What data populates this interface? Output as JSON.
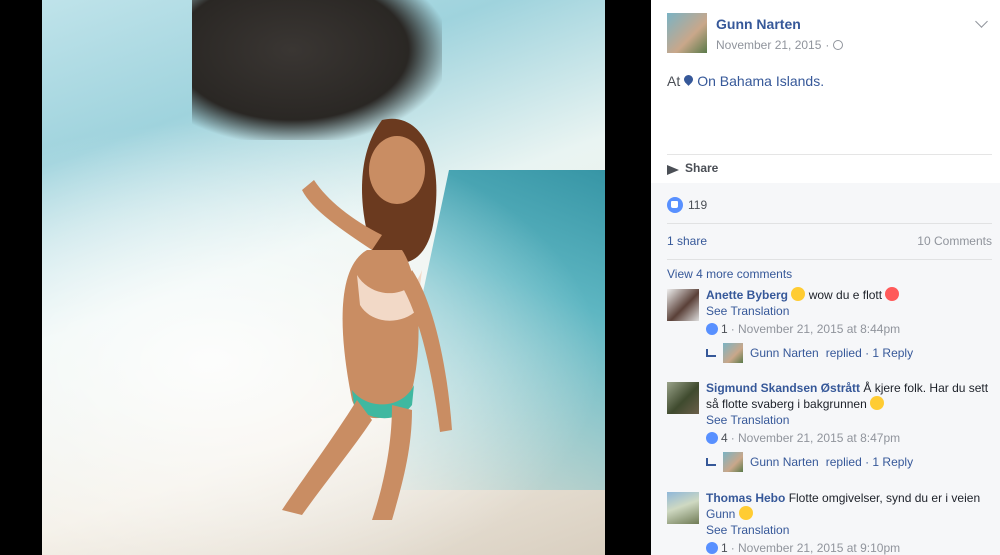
{
  "post": {
    "author": "Gunn Narten",
    "date": "November 21, 2015",
    "location_prefix": "At",
    "location": "On Bahama Islands.",
    "share_label": "Share",
    "likes_count": "119",
    "shares_text": "1 share",
    "comments_text": "10 Comments",
    "view_more": "View 4 more comments"
  },
  "comments": [
    {
      "name": "Anette Byberg",
      "text": "wow du e flott",
      "translate": "See Translation",
      "likes": "1",
      "timestamp": "· November 21, 2015 at 8:44pm",
      "reply_author": "Gunn Narten",
      "reply_text": "replied · 1 Reply"
    },
    {
      "name": "Sigmund Skandsen Østrått",
      "text": "Å kjere folk. Har du sett så flotte svaberg i bakgrunnen",
      "translate": "See Translation",
      "likes": "4",
      "timestamp": "· November 21, 2015 at 8:47pm",
      "reply_author": "Gunn Narten",
      "reply_text": "replied · 1 Reply"
    },
    {
      "name": "Thomas Hebo",
      "text": "Flotte omgivelser, synd du er i veien",
      "mention": "Gunn",
      "translate": "See Translation",
      "likes": "1",
      "timestamp": "· November 21, 2015 at 9:10pm"
    }
  ],
  "icons": {
    "like": "like-icon",
    "share": "share-icon",
    "location": "pin-icon",
    "privacy": "globe-icon",
    "options": "chevron-down-icon"
  },
  "colors": {
    "link": "#365899",
    "muted": "#90949c",
    "like_blue": "#5890ff",
    "ufi_bg": "#f6f7f9"
  }
}
